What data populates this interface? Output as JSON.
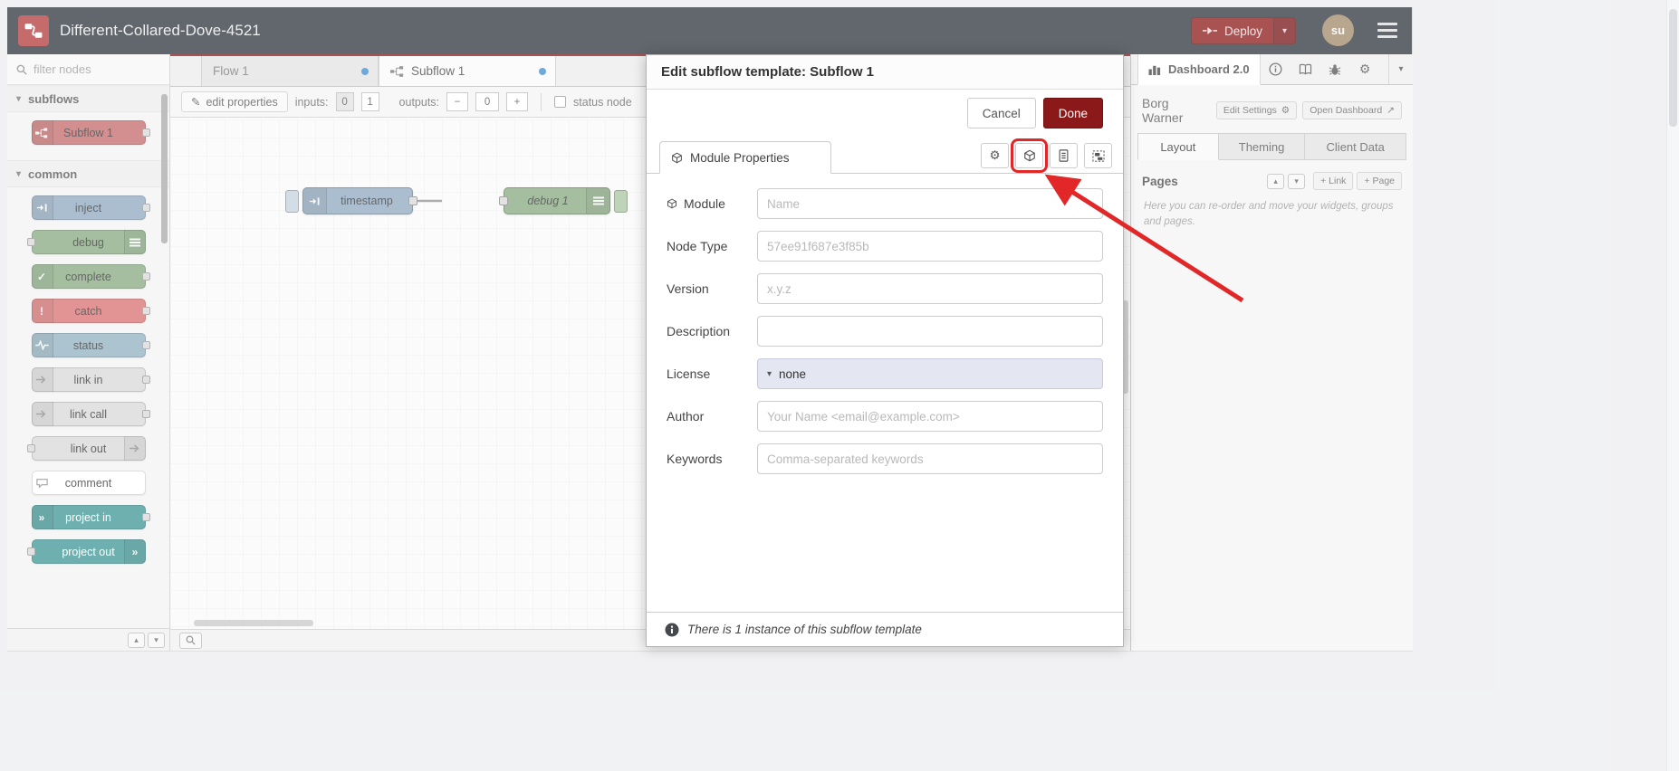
{
  "colors": {
    "accent_red": "#8C1919",
    "logo_red": "#b23a3a",
    "header_bg": "#2e353d",
    "annotation_red": "#e12727",
    "tab_dot_blue": "#3d8ecf",
    "node_subflow": "#c46a6a",
    "node_inject": "#8fa9c0",
    "node_debug": "#87a980",
    "node_complete": "#87a980",
    "node_catch": "#d97070",
    "node_status": "#8fb0c0",
    "node_link": "#d8d8d8",
    "node_comment": "#ffffff",
    "node_project": "#3e9696",
    "license_bg": "#e4e7f2"
  },
  "header": {
    "title": "Different-Collared-Dove-4521",
    "deploy_label": "Deploy",
    "user_initials": "su"
  },
  "palette": {
    "filter_placeholder": "filter nodes",
    "sections": [
      {
        "label": "subflows"
      },
      {
        "label": "common"
      }
    ],
    "subflow_nodes": [
      {
        "label": "Subflow 1"
      }
    ],
    "common_nodes": [
      {
        "label": "inject"
      },
      {
        "label": "debug"
      },
      {
        "label": "complete"
      },
      {
        "label": "catch"
      },
      {
        "label": "status"
      },
      {
        "label": "link in"
      },
      {
        "label": "link call"
      },
      {
        "label": "link out"
      },
      {
        "label": "comment"
      },
      {
        "label": "project in"
      },
      {
        "label": "project out"
      }
    ]
  },
  "workspace": {
    "tabs": [
      {
        "label": "Flow 1"
      },
      {
        "label": "Subflow 1"
      }
    ],
    "toolbar": {
      "edit_properties": "edit properties",
      "inputs_label": "inputs:",
      "input_zero": "0",
      "input_one": "1",
      "outputs_label": "outputs:",
      "minus": "−",
      "outputs_count": "0",
      "plus": "+",
      "status_node": "status node"
    },
    "nodes": {
      "inject_label": "timestamp",
      "debug_label": "debug 1"
    }
  },
  "dialog": {
    "title": "Edit subflow template: Subflow 1",
    "cancel_label": "Cancel",
    "done_label": "Done",
    "tab_label": "Module Properties",
    "fields": {
      "module": {
        "label": "Module",
        "placeholder": "Name"
      },
      "node_type": {
        "label": "Node Type",
        "placeholder": "57ee91f687e3f85b"
      },
      "version": {
        "label": "Version",
        "placeholder": "x.y.z"
      },
      "description": {
        "label": "Description",
        "placeholder": ""
      },
      "license": {
        "label": "License",
        "value": "none"
      },
      "author": {
        "label": "Author",
        "placeholder": "Your Name <email@example.com>"
      },
      "keywords": {
        "label": "Keywords",
        "placeholder": "Comma-separated keywords"
      }
    },
    "footer_note": "There is 1 instance of this subflow template"
  },
  "sidebar": {
    "dashboard_tab": "Dashboard 2.0",
    "owner": "Borg Warner",
    "edit_settings_label": "Edit Settings",
    "open_dashboard_label": "Open Dashboard",
    "tabs": [
      {
        "label": "Layout"
      },
      {
        "label": "Theming"
      },
      {
        "label": "Client Data"
      }
    ],
    "pages_label": "Pages",
    "add_link_label": "+ Link",
    "add_page_label": "+ Page",
    "help_text": "Here you can re-order and move your widgets, groups and pages."
  }
}
